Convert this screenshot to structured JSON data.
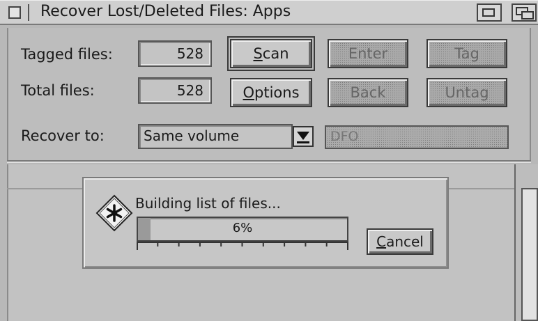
{
  "window": {
    "title": "Recover Lost/Deleted Files: Apps"
  },
  "stats": {
    "tagged_label": "Tagged files:",
    "tagged_value": "528",
    "total_label": "Total files:",
    "total_value": "528"
  },
  "buttons": {
    "scan_first": "S",
    "scan_rest": "can",
    "options_first": "O",
    "options_rest": "ptions",
    "enter": "Enter",
    "tag": "Tag",
    "back": "Back",
    "untag": "Untag"
  },
  "recover": {
    "label": "Recover to:",
    "selected": "Same volume",
    "destination": "DFO"
  },
  "progress_dialog": {
    "message": "Building list of files...",
    "percent_text": "6%",
    "percent_value": 6,
    "cancel_first": "C",
    "cancel_rest": "ancel"
  },
  "icons": {
    "dialog_icon": "asterisk-diamond-icon",
    "window_close": "close-box-icon",
    "window_zoom": "zoom-icon",
    "window_collapse": "collapse-icon"
  }
}
